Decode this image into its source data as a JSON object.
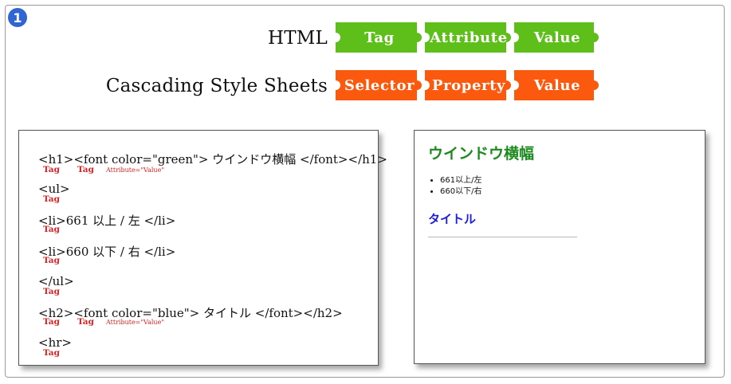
{
  "badge": "1",
  "rows": {
    "html": {
      "label": "HTML",
      "color": "#5fbf1a",
      "pieces": [
        "Tag",
        "Attribute",
        "Value"
      ]
    },
    "css": {
      "label": "Cascading Style Sheets",
      "color": "#fb5a0e",
      "pieces": [
        "Selector",
        "Property",
        "Value"
      ]
    }
  },
  "code": {
    "lines": [
      {
        "text": "<h1><font color=\"green\"> ウインドウ横幅 </font></h1>",
        "notes": [
          "Tag",
          "Tag"
        ],
        "attr_note": "Attribute=\"Value\""
      },
      {
        "text": "<ul>",
        "notes": [
          "Tag"
        ]
      },
      {
        "text": "<li>661 以上 / 左 </li>",
        "notes": [
          "Tag"
        ]
      },
      {
        "text": "<li>660 以下 / 右 </li>",
        "notes": [
          "Tag"
        ]
      },
      {
        "text": "</ul>",
        "notes": [
          "Tag"
        ]
      },
      {
        "text": "<h2><font color=\"blue\"> タイトル </font></h2>",
        "notes": [
          "Tag",
          "Tag"
        ],
        "attr_note": "Attribute=\"Value\""
      },
      {
        "text": "<hr>",
        "notes": [
          "Tag"
        ]
      }
    ],
    "note_color": "#d92323"
  },
  "preview": {
    "heading1": "ウインドウ横幅",
    "heading1_color": "#1c8a1c",
    "list_items": [
      "661以上/左",
      "660以下/右"
    ],
    "heading2": "タイトル",
    "heading2_color": "#1d1ddb"
  }
}
